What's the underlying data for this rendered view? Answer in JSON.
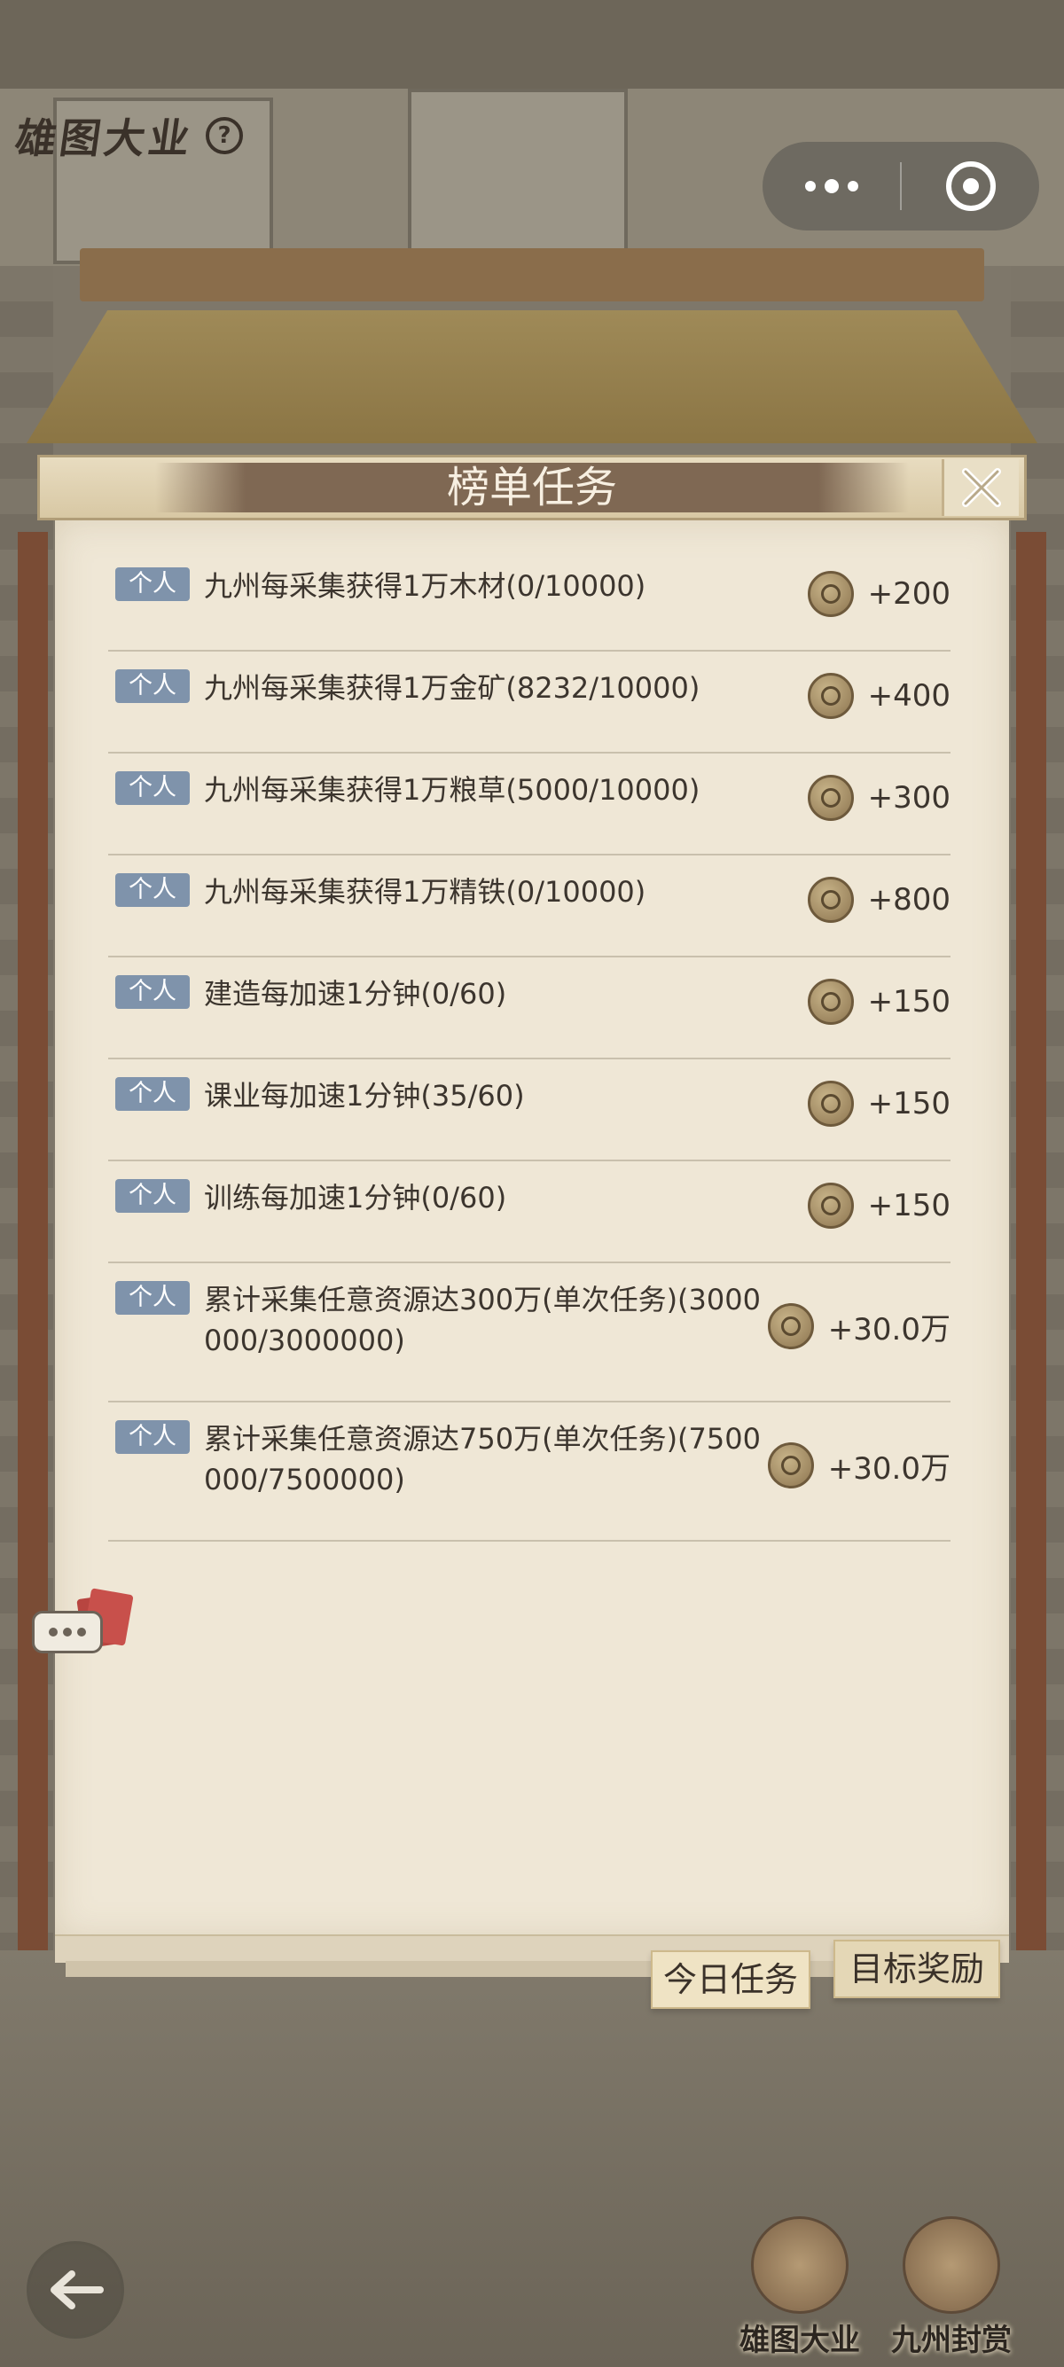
{
  "game": {
    "title": "雄图大业"
  },
  "panel": {
    "title": "榜单任务"
  },
  "tasks": [
    {
      "tag": "个人",
      "text": "九州每采集获得1万木材(0/10000)",
      "reward": "+200"
    },
    {
      "tag": "个人",
      "text": "九州每采集获得1万金矿(8232/10000)",
      "reward": "+400"
    },
    {
      "tag": "个人",
      "text": "九州每采集获得1万粮草(5000/10000)",
      "reward": "+300"
    },
    {
      "tag": "个人",
      "text": "九州每采集获得1万精铁(0/10000)",
      "reward": "+800"
    },
    {
      "tag": "个人",
      "text": "建造每加速1分钟(0/60)",
      "reward": "+150"
    },
    {
      "tag": "个人",
      "text": "课业每加速1分钟(35/60)",
      "reward": "+150"
    },
    {
      "tag": "个人",
      "text": "训练每加速1分钟(0/60)",
      "reward": "+150"
    },
    {
      "tag": "个人",
      "text": "累计采集任意资源达300万(单次任务)(3000000/3000000)",
      "reward": "+30.0万"
    },
    {
      "tag": "个人",
      "text": "累计采集任意资源达750万(单次任务)(7500000/7500000)",
      "reward": "+30.0万"
    }
  ],
  "tabs": {
    "today": "今日任务",
    "goal": "目标奖励"
  },
  "bottom_nav": [
    {
      "label": "雄图大业",
      "icon": "book-scroll-icon"
    },
    {
      "label": "九州封赏",
      "icon": "treasure-chest-icon"
    }
  ],
  "colors": {
    "tag_bg": "#7f93ab",
    "ribbon": "#7f6853",
    "paper": "#efe7d6"
  }
}
